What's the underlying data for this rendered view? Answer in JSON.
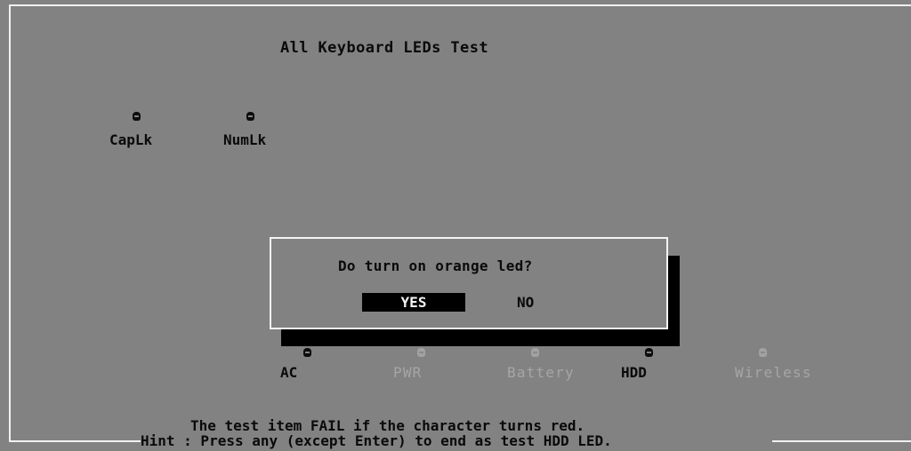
{
  "title": "All Keyboard LEDs Test",
  "keyboard_leds": [
    {
      "label": "CapLk",
      "state": "on"
    },
    {
      "label": "NumLk",
      "state": "on"
    }
  ],
  "dialog": {
    "question": "Do turn on orange led?",
    "yes_label": "YES",
    "no_label": "NO",
    "selected": "YES"
  },
  "system_leds": [
    {
      "label": "AC",
      "state": "on"
    },
    {
      "label": "PWR",
      "state": "off"
    },
    {
      "label": "Battery",
      "state": "off"
    },
    {
      "label": "HDD",
      "state": "on"
    },
    {
      "label": "Wireless",
      "state": "off"
    }
  ],
  "footer": {
    "line1": "The test item FAIL if the character turns red.",
    "line2": "Hint : Press any (except Enter) to end as test HDD LED."
  },
  "colors": {
    "background": "#828282",
    "text": "#0a0a0a",
    "inactive_text": "#a6a6a6",
    "frame": "#f0f0f0",
    "selected_button_bg": "#000000",
    "selected_button_text": "#f4f4f4"
  }
}
